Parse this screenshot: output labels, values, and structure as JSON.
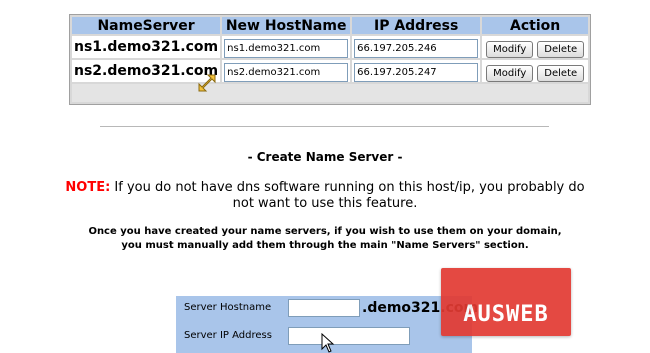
{
  "table": {
    "headers": [
      "NameServer",
      "New HostName",
      "IP Address",
      "Action"
    ],
    "rows": [
      {
        "nameserver": "ns1.demo321.com",
        "hostname": "ns1.demo321.com",
        "ip": "66.197.205.246"
      },
      {
        "nameserver": "ns2.demo321.com",
        "hostname": "ns2.demo321.com",
        "ip": "66.197.205.247"
      }
    ],
    "modify_label": "Modify",
    "delete_label": "Delete"
  },
  "create": {
    "title": "- Create Name Server -",
    "note_label": "NOTE:",
    "note_text": " If you do not have dns software running on this host/ip, you probably do not want to use this feature.",
    "info_text": "Once you have created your name servers, if you wish to use them on your domain, you must manually add them through the main \"Name Servers\" section.",
    "hostname_label": "Server Hostname",
    "hostname_value": "",
    "domain_suffix": ".demo321.com",
    "ip_label": "Server IP Address",
    "ip_value": ""
  },
  "logo": {
    "text": "AUSWEB"
  },
  "colors": {
    "header_bg": "#a9c5ea",
    "note_red": "#ff0000",
    "logo_red": "#e23a32"
  },
  "icons": [
    "resize-cursor-icon",
    "arrow-cursor-icon"
  ]
}
